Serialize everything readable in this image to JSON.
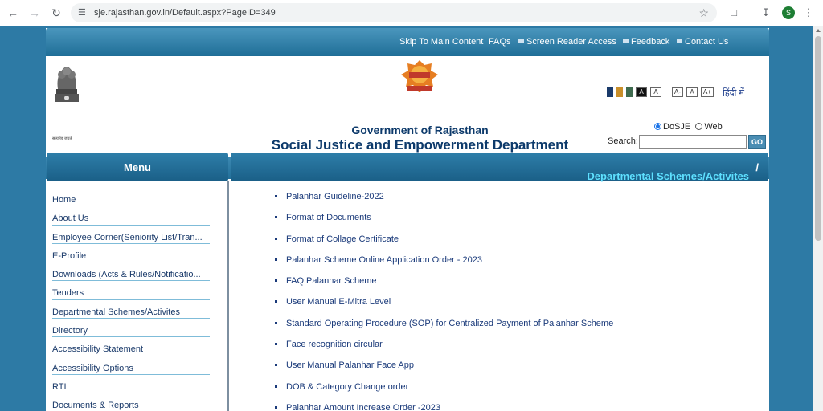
{
  "browser": {
    "url": "sje.rajasthan.gov.in/Default.aspx?PageID=349",
    "profile_initial": "S"
  },
  "topnav": {
    "links": [
      "Skip To Main Content",
      "FAQs",
      "Screen Reader Access",
      "Feedback",
      "Contact Us"
    ]
  },
  "header": {
    "gov_title": "Government of Rajasthan",
    "dept_title": "Social Justice and Empowerment Department",
    "emblem_caption": "सत्यमेव जयते",
    "contrast_swatches": [
      "#1a3a6a",
      "#c98f2a",
      "#3f6b4f"
    ],
    "contrast_buttons": [
      "A",
      "A"
    ],
    "font_buttons": [
      "A-",
      "A",
      "A+"
    ],
    "language_link": "हिंदी में",
    "search": {
      "options": [
        "DoSJE",
        "Web"
      ],
      "selected": "DoSJE",
      "label": "Search:",
      "value": "",
      "go_label": "GO"
    }
  },
  "menu": {
    "title": "Menu",
    "items": [
      "Home",
      "About Us",
      "Employee Corner(Seniority List/Tran...",
      "E-Profile",
      "Downloads (Acts & Rules/Notificatio...",
      "Tenders",
      "Departmental Schemes/Activites",
      "Directory",
      "Accessibility Statement",
      "Accessibility Options",
      "RTI",
      "Documents & Reports"
    ]
  },
  "content": {
    "title": "Departmental Schemes/Activites",
    "separator": "/",
    "items": [
      "Palanhar Guideline-2022",
      "Format of Documents",
      "Format of Collage Certificate",
      "Palanhar Scheme Online Application Order - 2023",
      "FAQ Palanhar Scheme",
      "User Manual E-Mitra Level",
      "Standard Operating Procedure (SOP) for Centralized Payment of Palanhar Scheme",
      "Face recognition circular",
      "User Manual Palanhar Face App",
      "DOB & Category Change order",
      "Palanhar Amount Increase Order -2023"
    ]
  }
}
